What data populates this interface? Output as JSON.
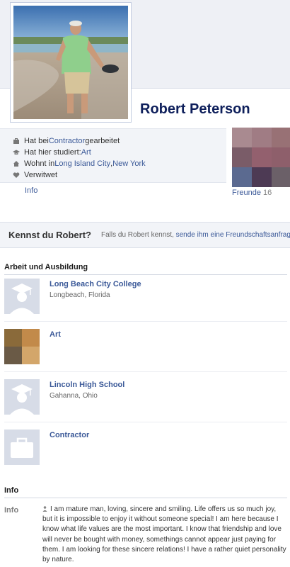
{
  "profile": {
    "name": "Robert Peterson"
  },
  "about": {
    "work": {
      "prefix": "Hat bei ",
      "link": "Contractor",
      "suffix": " gearbeitet"
    },
    "study": {
      "prefix": "Hat hier studiert: ",
      "link": "Art"
    },
    "lives": {
      "prefix": "Wohnt in ",
      "link1": "Long Island City",
      "sep": ", ",
      "link2": "New York"
    },
    "status": "Verwitwet",
    "info_link": "Info"
  },
  "friends": {
    "label": "Freunde",
    "count": "16",
    "colors": [
      "#a98a90",
      "#a07c84",
      "#987175",
      "#7a5c68",
      "#93606e",
      "#8e5f6b",
      "#5b6a90",
      "#4d3a54",
      "#6b6068"
    ]
  },
  "kennst": {
    "question": "Kennst du Robert?",
    "text": "Falls du Robert kennst, ",
    "link": "sende ihm eine Freundschaftsanfrage"
  },
  "work_education": {
    "title": "Arbeit und Ausbildung",
    "items": [
      {
        "name": "Long Beach City College",
        "sub": "Longbeach, Florida",
        "icon": "graduation-icon"
      },
      {
        "name": "Art",
        "sub": "",
        "icon": "art-thumbnail"
      },
      {
        "name": "Lincoln High School",
        "sub": "Gahanna, Ohio",
        "icon": "graduation-icon"
      },
      {
        "name": "Contractor",
        "sub": "",
        "icon": "briefcase-icon"
      }
    ]
  },
  "info_section": {
    "title": "Info",
    "label": "Info",
    "text": "I am mature man, loving, sincere and smiling. Life offers us so much joy, but it is impossible to enjoy it without someone special! I am here because I know what life values are the most important. I know that friendship and love will never be bought with money, somethings cannot appear just paying for them. I am looking for these sincere relations! I have a rather quiet personality by nature."
  },
  "colors": {
    "link": "#3b5998",
    "name": "#0e1f5b",
    "panel": "#f2f4f8"
  }
}
